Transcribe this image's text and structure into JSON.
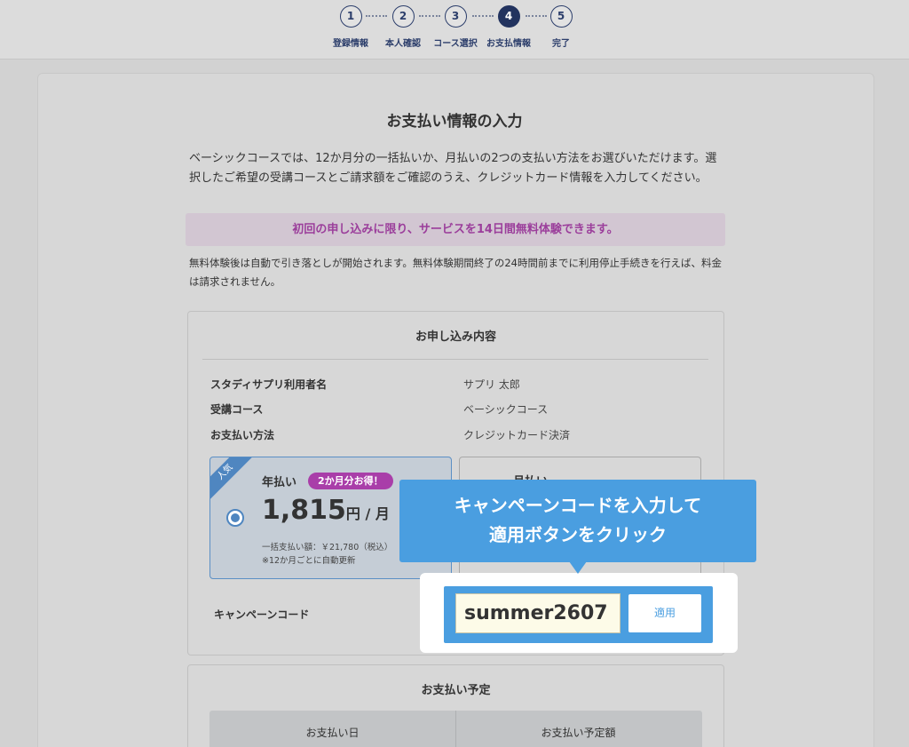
{
  "stepper": {
    "steps": [
      {
        "number": "1",
        "label": "登録情報"
      },
      {
        "number": "2",
        "label": "本人確認"
      },
      {
        "number": "3",
        "label": "コース選択"
      },
      {
        "number": "4",
        "label": "お支払情報"
      },
      {
        "number": "5",
        "label": "完了"
      }
    ],
    "active_step": "4"
  },
  "page": {
    "title": "お支払い情報の入力",
    "intro": "ベーシックコースでは、12か月分の一括払いか、月払いの2つの支払い方法をお選びいただけます。選択したご希望の受講コースとご請求額をご確認のうえ、クレジットカード情報を入力してください。",
    "trial_banner": "初回の申し込みに限り、サービスを14日間無料体験できます。",
    "trial_note": "無料体験後は自動で引き落としが開始されます。無料体験期間終了の24時間前までに利用停止手続きを行えば、料金は請求されません。"
  },
  "application": {
    "title": "お申し込み内容",
    "rows": [
      {
        "label": "スタディサプリ利用者名",
        "value": "サプリ 太郎"
      },
      {
        "label": "受講コース",
        "value": "ベーシックコース"
      },
      {
        "label": "お支払い方法",
        "value": "クレジットカード決済"
      }
    ],
    "annual_plan": {
      "ribbon": "人気",
      "name": "年払い",
      "badge": "2か月分お得！",
      "price": "1,815",
      "unit": "円 / 月",
      "note_line1": "一括支払い額：￥21,780（税込）",
      "note_line2": "※12か月ごとに自動更新",
      "selected": true
    },
    "monthly_plan": {
      "name": "月払い"
    },
    "campaign_label": "キャンペーンコード",
    "campaign_code_value": "summer2607",
    "apply_button": "適用"
  },
  "callout": {
    "line1": "キャンペーンコードを入力して",
    "line2": "適用ボタンをクリック"
  },
  "schedule": {
    "title": "お支払い予定",
    "col1": "お支払い日",
    "col2": "お支払い予定額"
  },
  "colors": {
    "accent": "#4a9ee0",
    "stepper_active": "#22335f",
    "promo": "#a93ea9"
  }
}
